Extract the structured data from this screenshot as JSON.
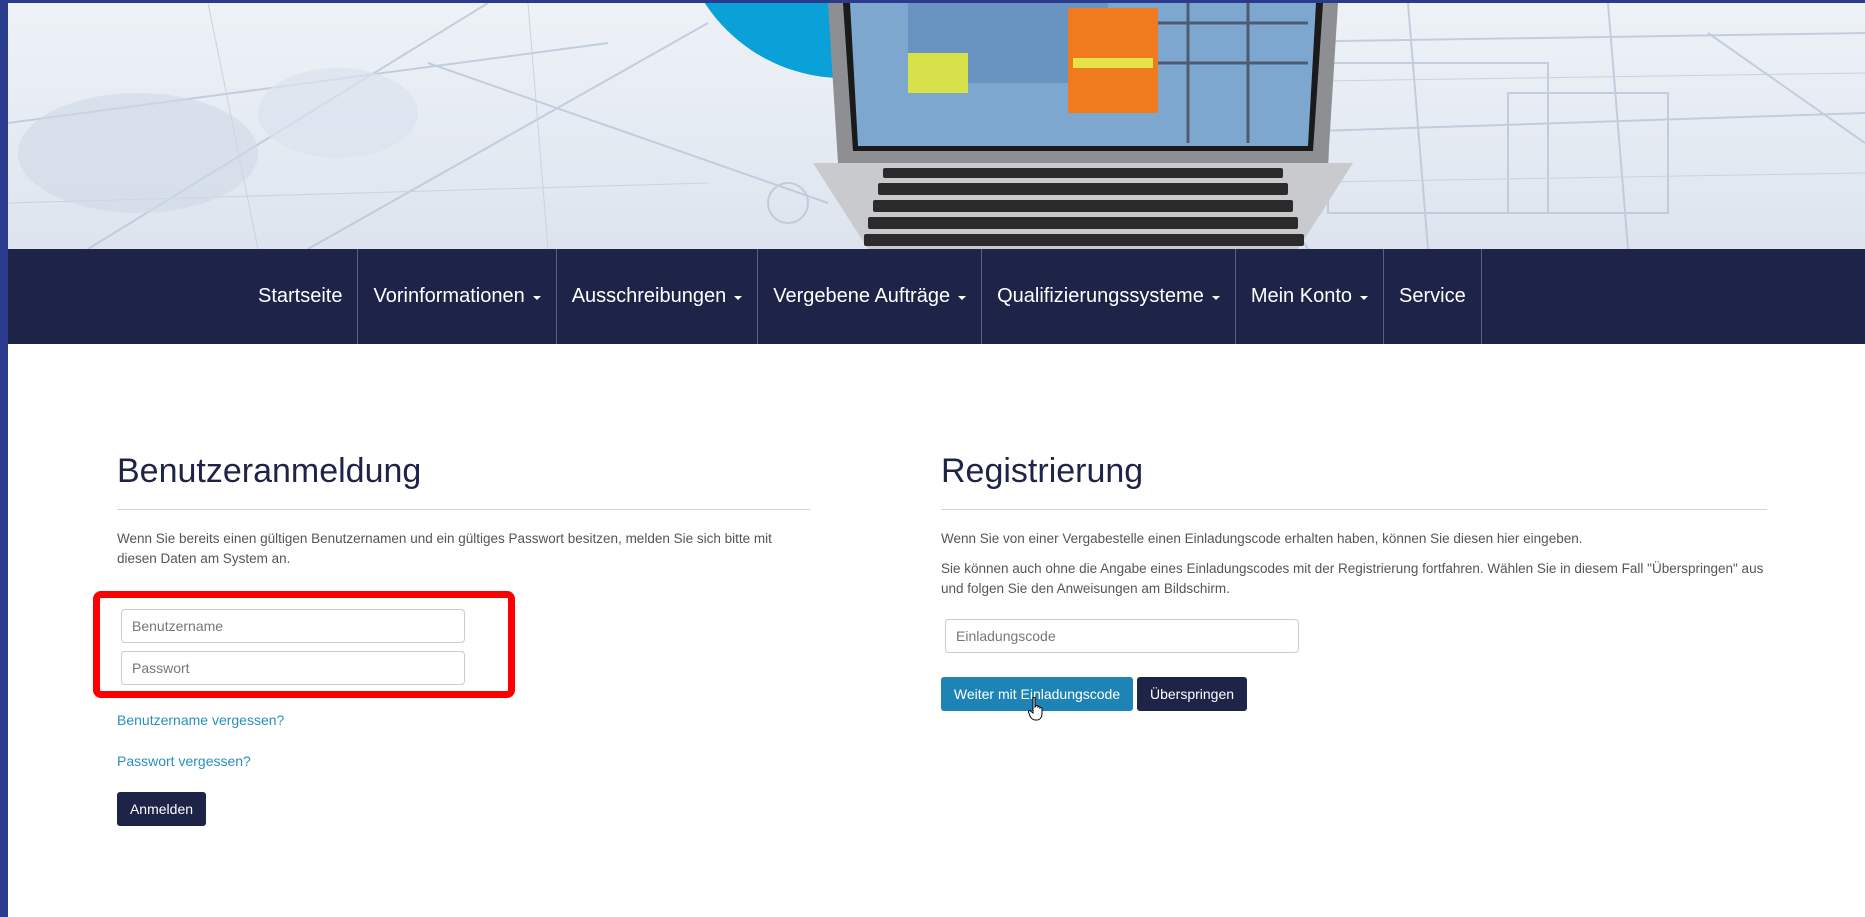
{
  "nav": {
    "items": [
      {
        "label": "Startseite",
        "dropdown": false
      },
      {
        "label": "Vorinformationen",
        "dropdown": true
      },
      {
        "label": "Ausschreibungen",
        "dropdown": true
      },
      {
        "label": "Vergebene Aufträge",
        "dropdown": true
      },
      {
        "label": "Qualifizierungssysteme",
        "dropdown": true
      },
      {
        "label": "Mein Konto",
        "dropdown": true
      },
      {
        "label": "Service",
        "dropdown": false
      }
    ]
  },
  "login": {
    "title": "Benutzeranmeldung",
    "description": "Wenn Sie bereits einen gültigen Benutzernamen und ein gültiges Passwort besitzen, melden Sie sich bitte mit diesen Daten am System an.",
    "username_placeholder": "Benutzername",
    "password_placeholder": "Passwort",
    "forgot_username": "Benutzername vergessen?",
    "forgot_password": "Passwort vergessen?",
    "submit_label": "Anmelden"
  },
  "registration": {
    "title": "Registrierung",
    "text1": "Wenn Sie von einer Vergabestelle einen Einladungscode erhalten haben, können Sie diesen hier eingeben.",
    "text2": "Sie können auch ohne die Angabe eines Einladungscodes mit der Registrierung fortfahren. Wählen Sie in diesem Fall \"Überspringen\" aus und folgen Sie den Anweisungen am Bildschirm.",
    "code_placeholder": "Einladungscode",
    "continue_label": "Weiter mit Einladungscode",
    "skip_label": "Überspringen"
  },
  "colors": {
    "nav_bg": "#1e2447",
    "primary_dark": "#1e2447",
    "primary_blue": "#1d84b5",
    "link": "#2a8fbd",
    "highlight": "#ff0000"
  }
}
